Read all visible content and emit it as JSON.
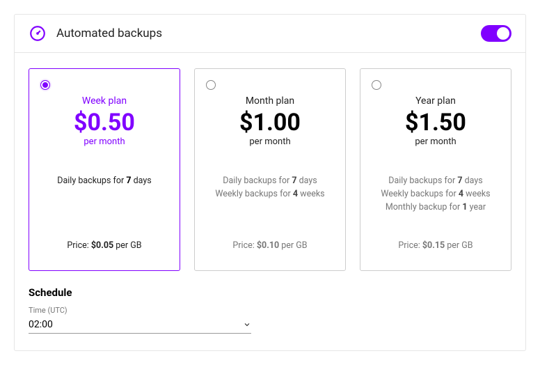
{
  "header": {
    "title": "Automated backups",
    "enabled": true
  },
  "plans": [
    {
      "name": "Week plan",
      "price": "$0.50",
      "per": "per month",
      "features": [
        {
          "pre": "Daily backups for ",
          "n": "7",
          "post": " days"
        }
      ],
      "price_gb_pre": "Price: ",
      "price_gb_val": "$0.05",
      "price_gb_post": " per GB",
      "selected": true
    },
    {
      "name": "Month plan",
      "price": "$1.00",
      "per": "per month",
      "features": [
        {
          "pre": "Daily backups for ",
          "n": "7",
          "post": " days"
        },
        {
          "pre": "Weekly backups for ",
          "n": "4",
          "post": " weeks"
        }
      ],
      "price_gb_pre": "Price: ",
      "price_gb_val": "$0.10",
      "price_gb_post": " per GB",
      "selected": false
    },
    {
      "name": "Year plan",
      "price": "$1.50",
      "per": "per month",
      "features": [
        {
          "pre": "Daily backups for ",
          "n": "7",
          "post": " days"
        },
        {
          "pre": "Weekly backups for ",
          "n": "4",
          "post": " weeks"
        },
        {
          "pre": "Monthly backup for ",
          "n": "1",
          "post": " year"
        }
      ],
      "price_gb_pre": "Price: ",
      "price_gb_val": "$0.15",
      "price_gb_post": " per GB",
      "selected": false
    }
  ],
  "schedule": {
    "title": "Schedule",
    "time_label": "Time (UTC)",
    "time_value": "02:00"
  }
}
